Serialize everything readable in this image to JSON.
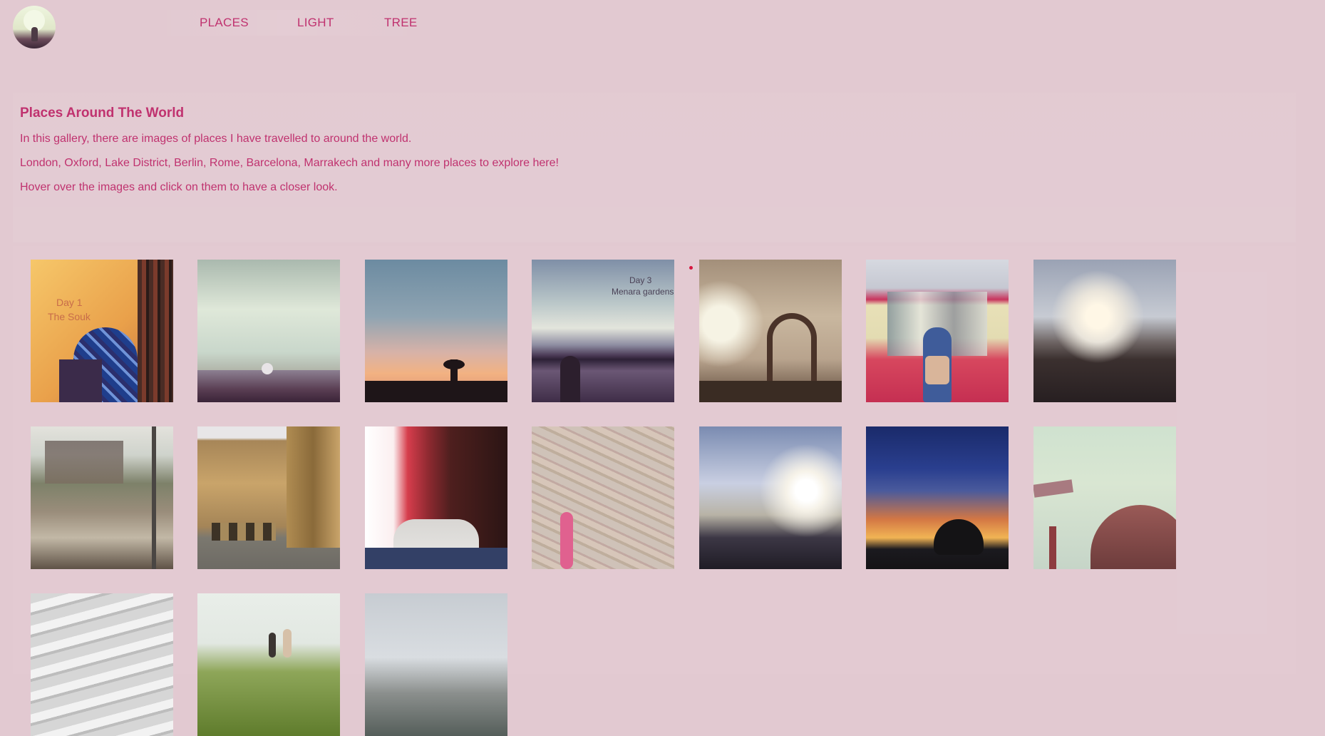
{
  "nav": {
    "items": [
      {
        "label": "PLACES"
      },
      {
        "label": "LIGHT"
      },
      {
        "label": "TREE"
      }
    ]
  },
  "intro": {
    "title": "Places Around The World",
    "lines": [
      "In this gallery, there are images of places I have travelled to around the world.",
      "London, Oxford, Lake District, Berlin, Rome, Barcelona, Marrakech and many more places to explore here!",
      "Hover over the images and click on them to have a closer look."
    ]
  },
  "gallery": {
    "photos": [
      {
        "name": "photo-souk",
        "caption_line1": "Day 1",
        "caption_line2": "The Souk"
      },
      {
        "name": "photo-london-skyline"
      },
      {
        "name": "photo-sunset-silhouette"
      },
      {
        "name": "photo-menara-gardens",
        "caption_line1": "Day 3",
        "caption_line2": "Menara gardens"
      },
      {
        "name": "photo-orbit-tower"
      },
      {
        "name": "photo-berlin-train"
      },
      {
        "name": "photo-memorial-blocks"
      },
      {
        "name": "photo-college-window"
      },
      {
        "name": "photo-oxford-street"
      },
      {
        "name": "photo-window-red-curtain"
      },
      {
        "name": "photo-graffiti-wall"
      },
      {
        "name": "photo-sunlit-crowd"
      },
      {
        "name": "photo-dusk-sky"
      },
      {
        "name": "photo-selfie-sky"
      },
      {
        "name": "photo-roof-grey"
      },
      {
        "name": "photo-valley-hikers"
      },
      {
        "name": "photo-cloudy-hills"
      }
    ]
  },
  "colors": {
    "background": "#e2c9d1",
    "accent": "#c0326f"
  }
}
